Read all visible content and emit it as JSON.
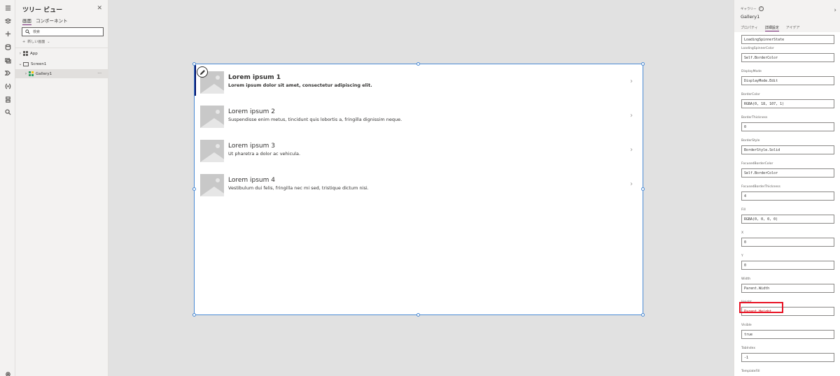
{
  "left_rail": {
    "icons": [
      "hamburger-icon",
      "layers-icon",
      "plus-icon",
      "database-icon",
      "media-icon",
      "power-automate-icon",
      "variables-icon",
      "tools-icon",
      "search-icon",
      "settings-icon"
    ]
  },
  "tree_view": {
    "title": "ツリー ビュー",
    "tabs": [
      {
        "label": "画面",
        "active": true
      },
      {
        "label": "コンポーネント",
        "active": false
      }
    ],
    "search_placeholder": "検索",
    "new_screen_label": "新しい画面",
    "rows": [
      {
        "label": "App",
        "kind": "app"
      },
      {
        "label": "Screen1",
        "kind": "screen"
      },
      {
        "label": "Gallery1",
        "kind": "gallery",
        "selected": true
      }
    ]
  },
  "gallery": {
    "items": [
      {
        "title": "Lorem ipsum 1",
        "subtitle": "Lorem ipsum dolor sit amet, consectetur adipiscing elit.",
        "selected": true
      },
      {
        "title": "Lorem ipsum 2",
        "subtitle": "Suspendisse enim metus, tincidunt quis lobortis a, fringilla dignissim neque.",
        "selected": false
      },
      {
        "title": "Lorem ipsum 3",
        "subtitle": "Ut pharetra a dolor ac vehicula.",
        "selected": false
      },
      {
        "title": "Lorem ipsum 4",
        "subtitle": "Vestibulum dui felis, fringilla nec mi sed, tristique dictum nisi.",
        "selected": false
      }
    ],
    "chevron": "›"
  },
  "properties": {
    "kind_label": "ギャラリー",
    "control_name": "Gallery1",
    "tabs": [
      {
        "label": "プロパティ",
        "active": false
      },
      {
        "label": "詳細設定",
        "active": true
      },
      {
        "label": "アイデア",
        "active": false
      }
    ],
    "fields": [
      {
        "label": "",
        "value": "LoadingSpinnerState",
        "highlighted": false
      },
      {
        "label": "LoadingSpinnerColor",
        "value": "Self.BorderColor",
        "highlighted": false
      },
      {
        "label": "DisplayMode",
        "value": "DisplayMode.Edit",
        "highlighted": false
      },
      {
        "label": "BorderColor",
        "value": "RGBA(0, 18, 107, 1)",
        "highlighted": false
      },
      {
        "label": "BorderThickness",
        "value": "0",
        "highlighted": false
      },
      {
        "label": "BorderStyle",
        "value": "BorderStyle.Solid",
        "highlighted": false
      },
      {
        "label": "FocusedBorderColor",
        "value": "Self.BorderColor",
        "highlighted": false
      },
      {
        "label": "FocusedBorderThickness",
        "value": "4",
        "highlighted": false
      },
      {
        "label": "Fill",
        "value": "RGBA(0, 0, 0, 0)",
        "highlighted": false
      },
      {
        "label": "X",
        "value": "0",
        "highlighted": false
      },
      {
        "label": "Y",
        "value": "0",
        "highlighted": false
      },
      {
        "label": "Width",
        "value": "Parent.Width",
        "highlighted": false
      },
      {
        "label": "Height",
        "value": "Parent.Height",
        "highlighted": true
      },
      {
        "label": "Visible",
        "value": "true",
        "highlighted": false
      },
      {
        "label": "TabIndex",
        "value": "-1",
        "highlighted": false
      },
      {
        "label": "TemplateFill",
        "value": "",
        "highlighted": false
      }
    ]
  },
  "colors": {
    "accent": "#742774",
    "gallery_selection_bar": "#000f6b",
    "selection_handles": "#4a8ad4",
    "highlight_box": "#e81123"
  }
}
